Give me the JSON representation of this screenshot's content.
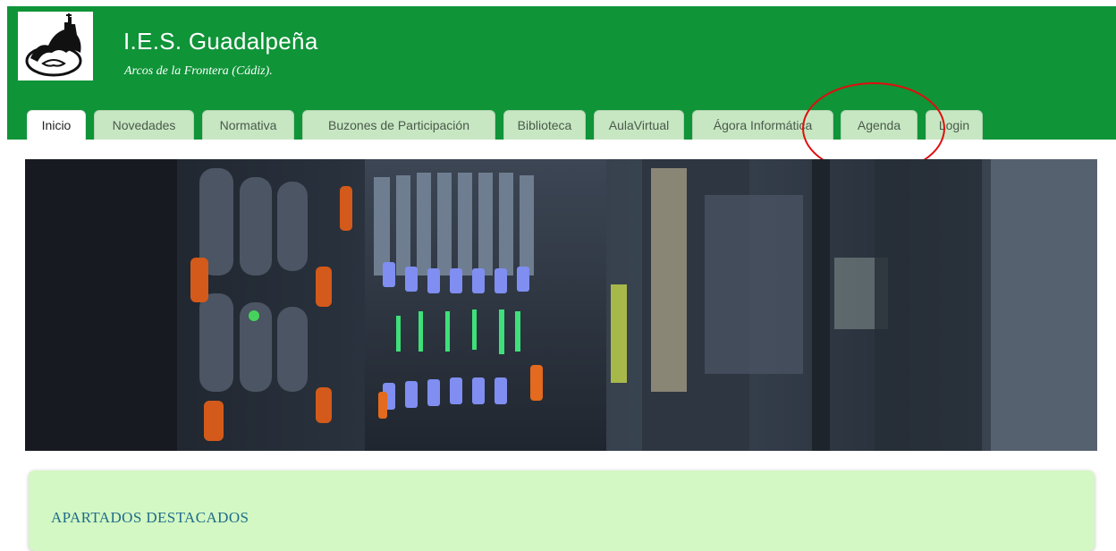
{
  "site": {
    "title": "I.E.S. Guadalpeña",
    "subtitle": "Arcos de la Frontera (Cádiz).",
    "brand_color": "#0f9438",
    "logo_icon": "castle-logo-icon"
  },
  "nav": {
    "tabs": [
      {
        "label": "Inicio",
        "active": true
      },
      {
        "label": "Novedades"
      },
      {
        "label": "Normativa"
      },
      {
        "label": "Buzones de Participación"
      },
      {
        "label": "Biblioteca"
      },
      {
        "label": "AulaVirtual"
      },
      {
        "label": "Ágora Informática"
      },
      {
        "label": "Agenda"
      },
      {
        "label": "Login"
      }
    ],
    "tab_color": "#c7e7c3"
  },
  "annotation": {
    "color": "#e00d0d"
  },
  "banner": {
    "icon": "server-rack-banner-image"
  },
  "featured": {
    "title": "APARTADOS DESTACADOS",
    "background": "#d3f8c3"
  }
}
